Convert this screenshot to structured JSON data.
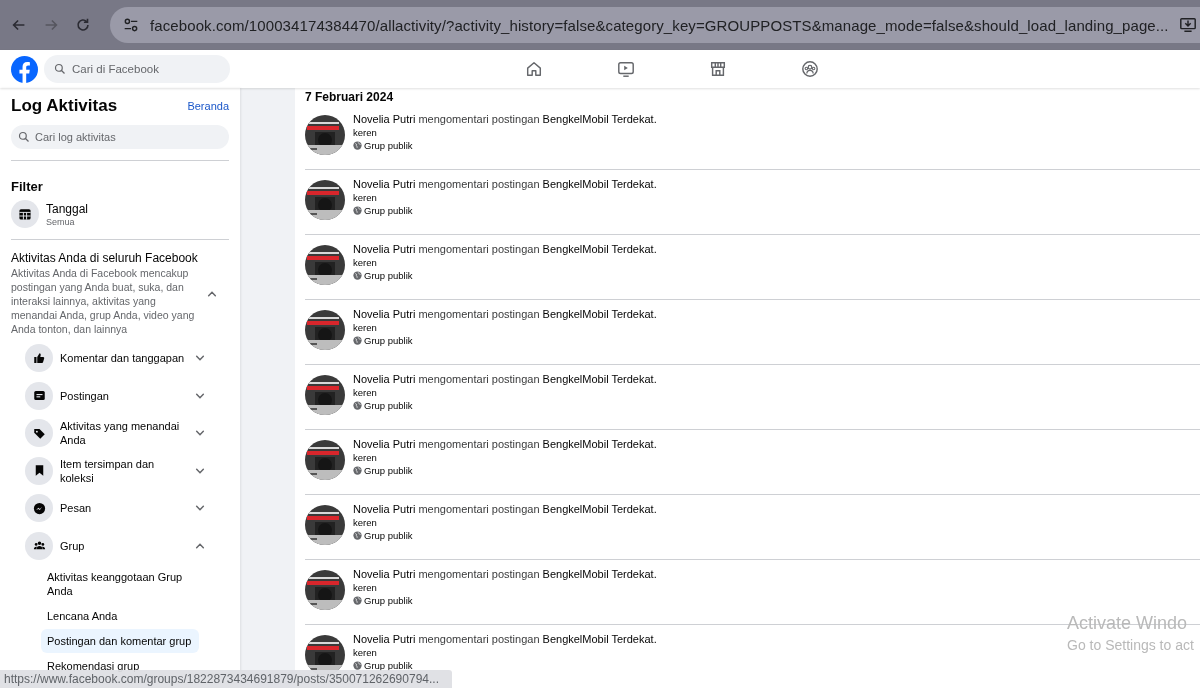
{
  "browser": {
    "url": "facebook.com/100034174384470/allactivity/?activity_history=false&category_key=GROUPPOSTS&manage_mode=false&should_load_landing_page...",
    "status_url": "https://www.facebook.com/groups/1822873434691879/posts/350071262690794..."
  },
  "header": {
    "search_placeholder": "Cari di Facebook"
  },
  "sidebar": {
    "title": "Log Aktivitas",
    "home_link": "Beranda",
    "search_placeholder": "Cari log aktivitas",
    "filter_heading": "Filter",
    "filters": [
      {
        "label": "Tanggal",
        "value": "Semua"
      }
    ],
    "section": {
      "title": "Aktivitas Anda di seluruh Facebook",
      "description": "Aktivitas Anda di Facebook mencakup postingan yang Anda buat, suka, dan interaksi lainnya, aktivitas yang menandai Anda, grup Anda, video yang Anda tonton, dan lainnya",
      "expanded": true
    },
    "categories": [
      {
        "label": "Komentar dan tanggapan",
        "expanded": false
      },
      {
        "label": "Postingan",
        "expanded": false
      },
      {
        "label": "Aktivitas yang menandai Anda",
        "expanded": false
      },
      {
        "label": "Item tersimpan dan koleksi",
        "expanded": false
      },
      {
        "label": "Pesan",
        "expanded": false
      },
      {
        "label": "Grup",
        "expanded": true,
        "children": [
          {
            "label": "Aktivitas keanggotaan Grup Anda",
            "selected": false
          },
          {
            "label": "Lencana Anda",
            "selected": false
          },
          {
            "label": "Postingan dan komentar grup",
            "selected": true
          },
          {
            "label": "Rekomendasi grup",
            "selected": false
          }
        ]
      }
    ]
  },
  "feed": {
    "date": "7 Februari 2024",
    "items": [
      {
        "actor": "Novelia Putri",
        "action": "mengomentari postingan",
        "target": "BengkelMobil Terdekat.",
        "comment": "keren",
        "audience": "Grup publik"
      },
      {
        "actor": "Novelia Putri",
        "action": "mengomentari postingan",
        "target": "BengkelMobil Terdekat.",
        "comment": "keren",
        "audience": "Grup publik"
      },
      {
        "actor": "Novelia Putri",
        "action": "mengomentari postingan",
        "target": "BengkelMobil Terdekat.",
        "comment": "keren",
        "audience": "Grup publik"
      },
      {
        "actor": "Novelia Putri",
        "action": "mengomentari postingan",
        "target": "BengkelMobil Terdekat.",
        "comment": "keren",
        "audience": "Grup publik"
      },
      {
        "actor": "Novelia Putri",
        "action": "mengomentari postingan",
        "target": "BengkelMobil Terdekat.",
        "comment": "keren",
        "audience": "Grup publik"
      },
      {
        "actor": "Novelia Putri",
        "action": "mengomentari postingan",
        "target": "BengkelMobil Terdekat.",
        "comment": "keren",
        "audience": "Grup publik"
      },
      {
        "actor": "Novelia Putri",
        "action": "mengomentari postingan",
        "target": "BengkelMobil Terdekat.",
        "comment": "keren",
        "audience": "Grup publik"
      },
      {
        "actor": "Novelia Putri",
        "action": "mengomentari postingan",
        "target": "BengkelMobil Terdekat.",
        "comment": "keren",
        "audience": "Grup publik"
      },
      {
        "actor": "Novelia Putri",
        "action": "mengomentari postingan",
        "target": "BengkelMobil Terdekat.",
        "comment": "keren",
        "audience": "Grup publik"
      }
    ]
  },
  "system_notice": {
    "title": "Activate Windo",
    "subtitle": "Go to Settings to act"
  }
}
